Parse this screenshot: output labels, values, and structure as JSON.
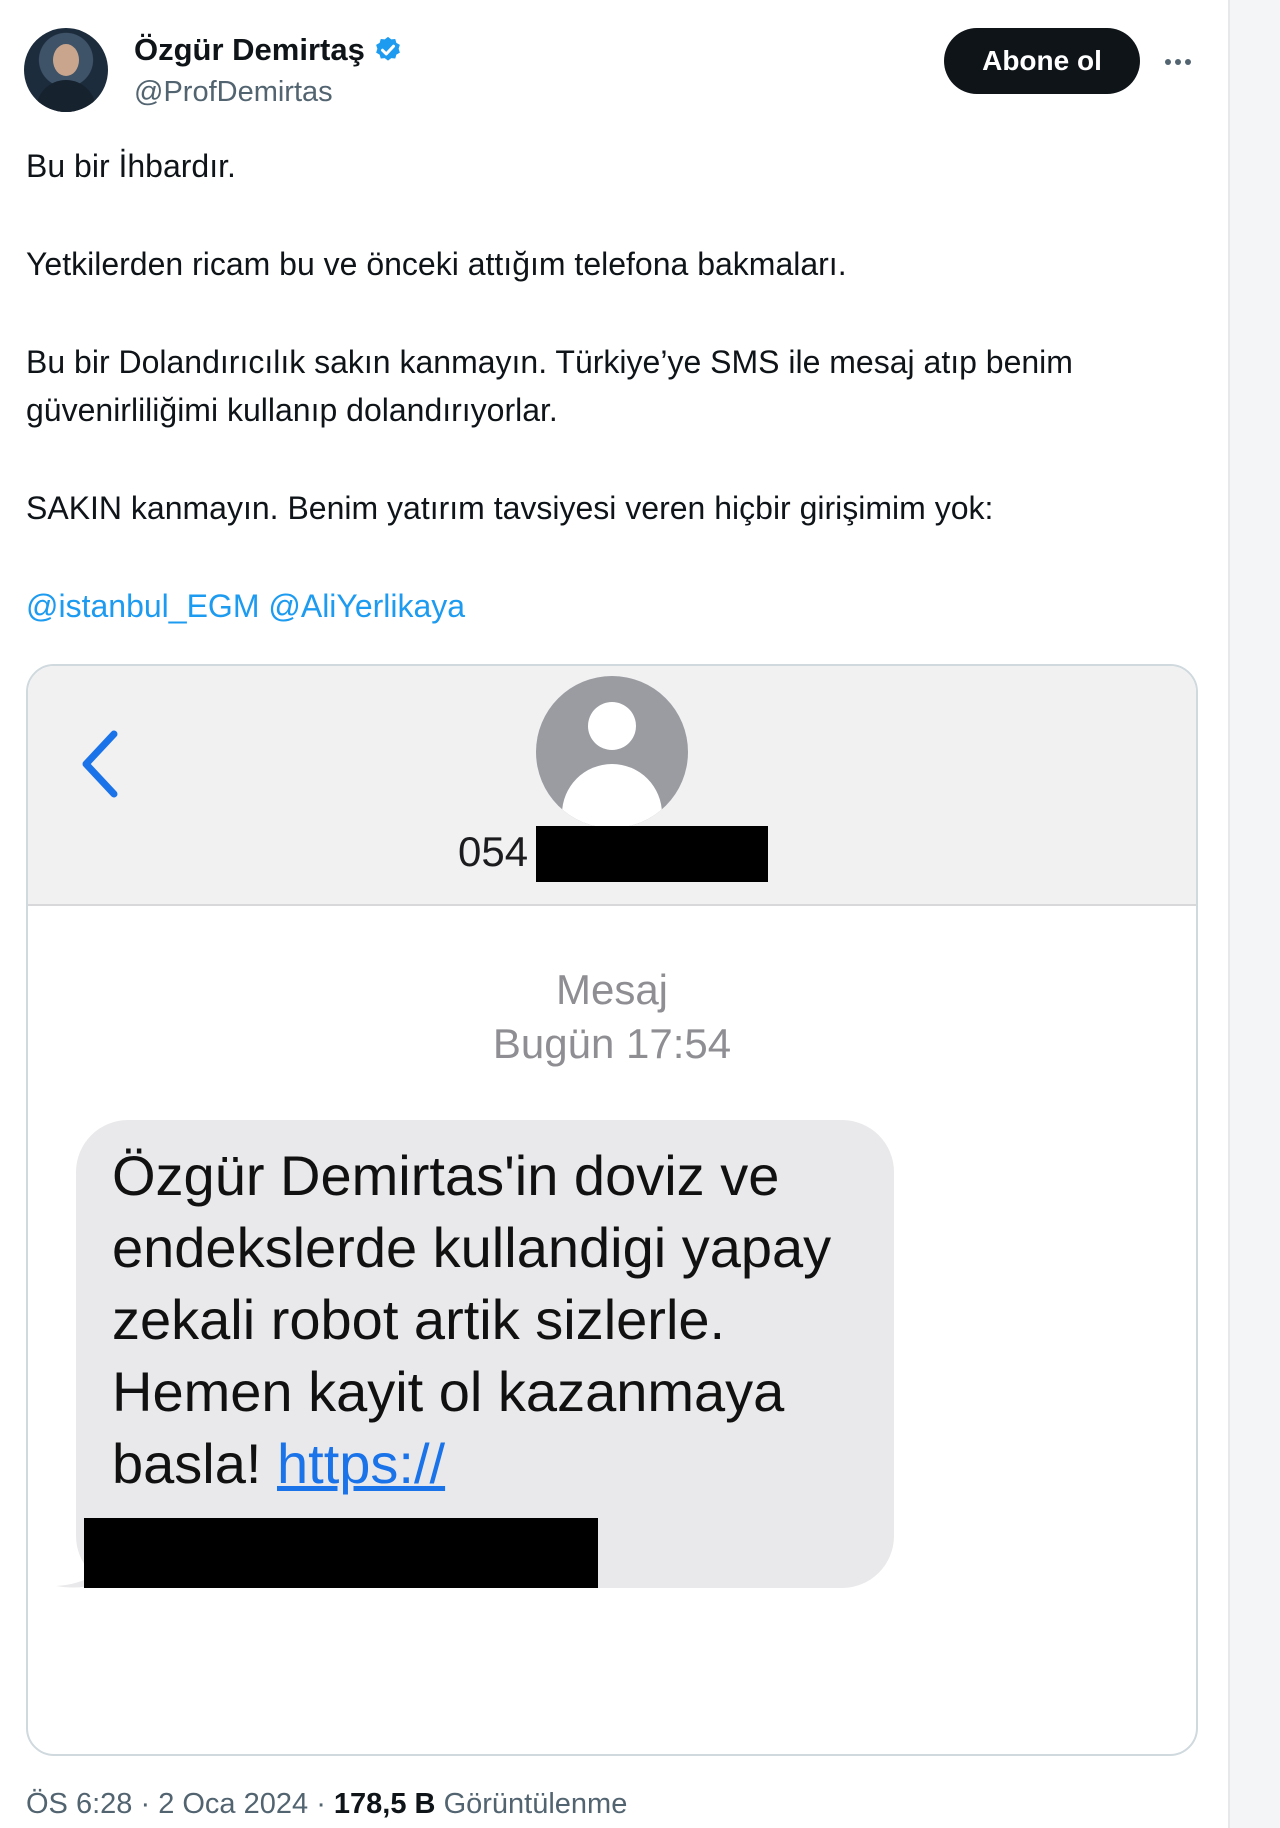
{
  "author": {
    "display_name": "Özgür Demirtaş",
    "handle": "@ProfDemirtas",
    "verified": true
  },
  "actions": {
    "follow_label": "Abone ol"
  },
  "tweet": {
    "line1": "Bu bir İhbardır.",
    "line2": "Yetkilerden ricam bu ve önceki attığım telefona bakmaları.",
    "line3": "Bu bir Dolandırıcılık sakın kanmayın. Türkiye’ye SMS ile mesaj atıp benim güvenirliliğimi kullanıp dolandırıyorlar.",
    "line4": "SAKIN kanmayın. Benim yatırım tavsiyesi veren hiçbir girişimim yok:",
    "mentions": [
      "@istanbul_EGM",
      "@AliYerlikaya"
    ]
  },
  "sms": {
    "number_prefix": "054",
    "meta_label": "Mesaj",
    "meta_time": "Bugün 17:54",
    "message": "Özgür Demirtas'in doviz ve endekslerde kullandigi yapay zekali robot artik sizlerle. Hemen kayit ol kazanmaya basla! ",
    "link": "https://"
  },
  "footer": {
    "time": "ÖS 6:28",
    "date": "2 Oca 2024",
    "views_count": "178,5 B",
    "views_label": "Görüntülenme",
    "separator": " · "
  },
  "colors": {
    "accent": "#1d9bf0",
    "text": "#0f1419",
    "muted": "#536471",
    "ios_blue": "#1a73e8"
  }
}
